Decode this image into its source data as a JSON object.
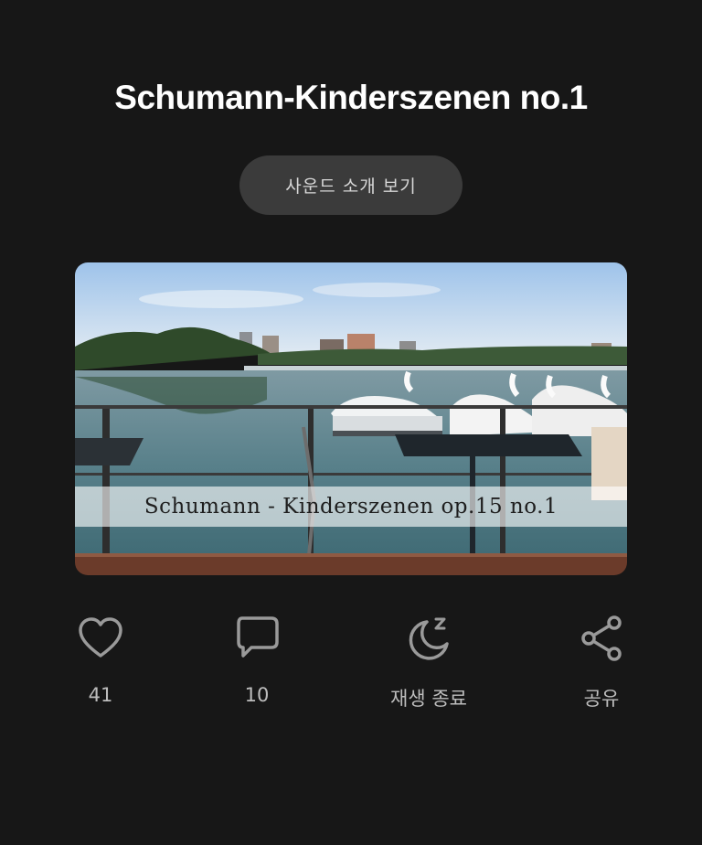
{
  "page": {
    "title": "Schumann-Kinderszenen no.1",
    "intro_button_label": "사운드 소개 보기"
  },
  "cover": {
    "caption": "Schumann - Kinderszenen op.15 no.1"
  },
  "actions": [
    {
      "icon": "heart-icon",
      "label": "41"
    },
    {
      "icon": "comment-icon",
      "label": "10"
    },
    {
      "icon": "moon-sleep-icon",
      "label": "재생 종료"
    },
    {
      "icon": "share-icon",
      "label": "공유"
    }
  ],
  "colors": {
    "background": "#171717",
    "button_bg": "#3b3b3b",
    "icon": "#9a9a9a",
    "label": "#bdbdbd"
  }
}
